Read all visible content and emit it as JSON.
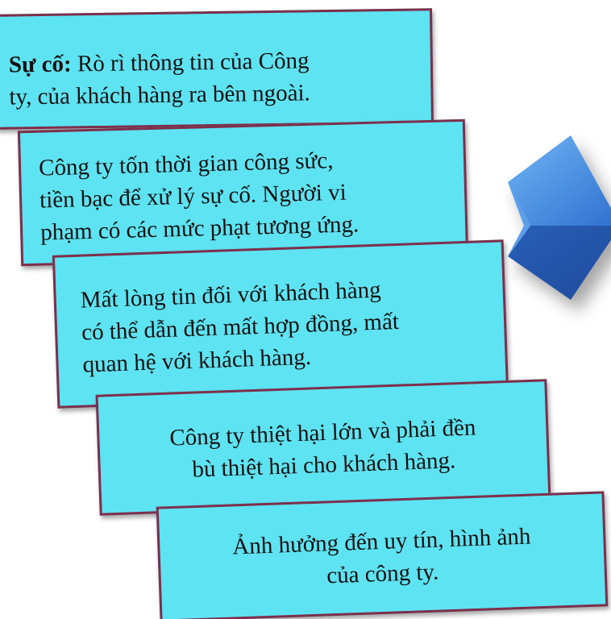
{
  "colors": {
    "box_fill": "#5ee3f2",
    "box_border": "#7d2f4b",
    "arrow_blue": "#2f6fd0"
  },
  "icons": {
    "arrow": "chevron-right-arrow-icon"
  },
  "boxes": [
    {
      "label": "Sự cố:",
      "text_lines": [
        "Rò rì thông tin của Công",
        "ty, của khách hàng ra bên ngoài."
      ]
    },
    {
      "text_lines": [
        "Công ty tốn thời gian công sức,",
        "tiền bạc để xử lý sự cố. Người vi",
        "phạm có các mức phạt tương ứng."
      ]
    },
    {
      "text_lines": [
        "Mất lòng tin đối với khách hàng",
        "có thể dẫn đến mất hợp đồng, mất",
        "quan hệ với khách hàng."
      ]
    },
    {
      "text_lines": [
        "Công ty thiệt hại lớn và phải đền",
        "bù thiệt hại cho khách hàng."
      ]
    },
    {
      "text_lines": [
        "Ảnh hưởng đến uy tín, hình ảnh",
        "của công ty."
      ]
    }
  ]
}
